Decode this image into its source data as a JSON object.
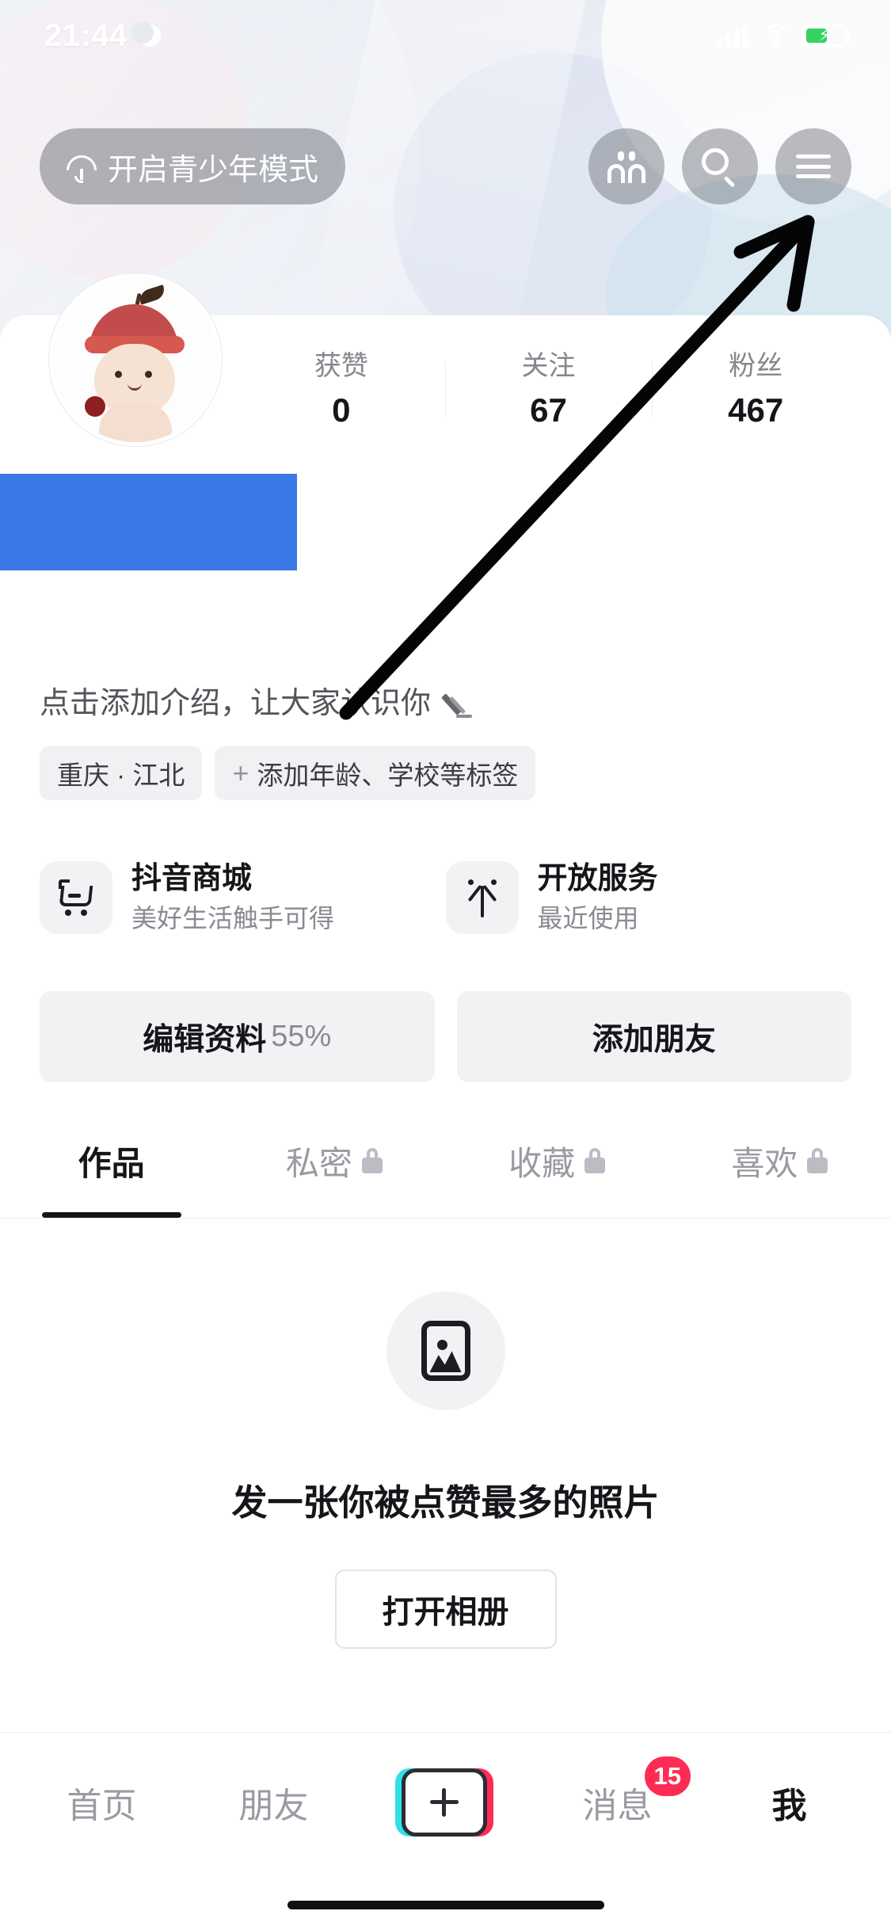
{
  "status_bar": {
    "time": "21:44",
    "dnd_icon": "moon-icon",
    "signal_icon": "cellular-signal-icon",
    "wifi_icon": "wifi-icon",
    "battery_icon": "battery-charging-icon"
  },
  "header": {
    "teen_mode_label": "开启青少年模式",
    "teen_mode_icon": "umbrella-icon",
    "friends_icon": "friends-icon",
    "search_icon": "search-icon",
    "menu_icon": "hamburger-menu-icon"
  },
  "profile": {
    "avatar_name": "avatar",
    "nickname_redacted": true,
    "stats": [
      {
        "label": "获赞",
        "value": "0"
      },
      {
        "label": "关注",
        "value": "67"
      },
      {
        "label": "粉丝",
        "value": "467"
      }
    ],
    "bio_placeholder": "点击添加介绍，让大家认识你",
    "edit_bio_icon": "pencil-icon",
    "tags": [
      {
        "text": "重庆 · 江北",
        "has_plus": false
      },
      {
        "text": "添加年龄、学校等标签",
        "has_plus": true,
        "plus": "+"
      }
    ]
  },
  "services": [
    {
      "title": "抖音商城",
      "subtitle": "美好生活触手可得",
      "icon": "shopping-cart-icon"
    },
    {
      "title": "开放服务",
      "subtitle": "最近使用",
      "icon": "douyin-star-icon"
    }
  ],
  "actions": {
    "edit_profile_label": "编辑资料",
    "edit_profile_percent": "55%",
    "add_friend_label": "添加朋友"
  },
  "tabs": [
    {
      "label": "作品",
      "locked": false,
      "active": true
    },
    {
      "label": "私密",
      "locked": true,
      "active": false
    },
    {
      "label": "收藏",
      "locked": true,
      "active": false
    },
    {
      "label": "喜欢",
      "locked": true,
      "active": false
    }
  ],
  "empty_state": {
    "icon": "photo-placeholder-icon",
    "title": "发一张你被点赞最多的照片",
    "button_label": "打开相册"
  },
  "bottom_nav": {
    "items": [
      {
        "label": "首页",
        "active": false
      },
      {
        "label": "朋友",
        "active": false
      },
      {
        "label": "",
        "active": false,
        "icon": "plus-create-icon"
      },
      {
        "label": "消息",
        "active": false,
        "badge": "15"
      },
      {
        "label": "我",
        "active": true
      }
    ]
  },
  "annotation": {
    "arrow": "pointer-arrow-to-menu-icon",
    "color": "#000000"
  },
  "colors": {
    "accent_pink": "#fe2c55",
    "accent_cyan": "#30e0e8",
    "text_primary": "#16161a",
    "text_secondary": "#8a8a92",
    "chip_bg": "#f1f1f4",
    "redaction": "#3a78e7",
    "battery_green": "#36d260"
  }
}
